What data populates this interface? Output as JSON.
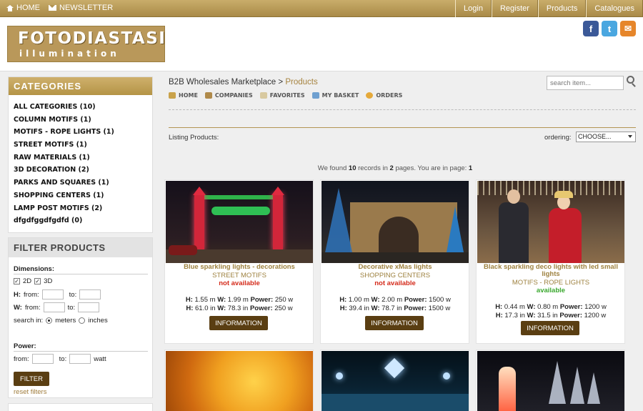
{
  "topbar": {
    "home": "HOME",
    "newsletter": "NEWSLETTER",
    "login": "Login",
    "register": "Register",
    "products": "Products",
    "catalogues": "Catalogues"
  },
  "brand": {
    "line1": "FOTODIASTASI",
    "line2": "illumination"
  },
  "social": {
    "facebook": "f",
    "twitter": "t",
    "email": "✉"
  },
  "sidebar": {
    "categories_title": "CATEGORIES",
    "categories": [
      "ALL CATEGORIES (10)",
      "COLUMN MOTIFS (1)",
      "MOTIFS - ROPE LIGHTS (1)",
      "STREET MOTIFS (1)",
      "RAW MATERIALS (1)",
      "3D DECORATION (2)",
      "PARKS AND SQUARES (1)",
      "SHOPPING CENTERS (1)",
      "LAMP POST MOTIFS (2)",
      "dfgdfggdfgdfd (0)"
    ],
    "filter": {
      "title": "FILTER PRODUCTS",
      "dimensions": "Dimensions:",
      "opt_2d": "2D",
      "opt_3d": "3D",
      "h_label": "H:",
      "w_label": "W:",
      "from": "from:",
      "to": "to:",
      "search_in": "search in:",
      "meters": "meters",
      "inches": "inches",
      "power": "Power:",
      "watt": "watt",
      "button": "FILTER",
      "reset": "reset filters"
    }
  },
  "main": {
    "breadcrumb_root": "B2B Wholesales Marketplace",
    "breadcrumb_sep": ">",
    "breadcrumb_current": "Products",
    "search_placeholder": "search item...",
    "subnav": [
      "HOME",
      "COMPANIES",
      "FAVORITES",
      "MY BASKET",
      "ORDERS"
    ],
    "listing": "Listing Products:",
    "ordering_label": "ordering:",
    "ordering_value": "CHOOSE...",
    "found": {
      "pre": "We found",
      "records": "10",
      "mid": "records in",
      "pages": "2",
      "post": "pages. You are in page:",
      "page": "1"
    }
  },
  "products": [
    {
      "title": "Blue sparkling lights - decorations",
      "category": "STREET MOTIFS",
      "availability": "not available",
      "availability_color": "#d42a1a",
      "h_m": "1.55 m",
      "w_m": "1.99 m",
      "p1": "250 w",
      "h_in": "61.0 in",
      "w_in": "78.3 in",
      "p2": "250 w",
      "button": "INFORMATION"
    },
    {
      "title": "Decorative xMas lights",
      "category": "SHOPPING CENTERS",
      "availability": "not available",
      "availability_color": "#d42a1a",
      "h_m": "1.00 m",
      "w_m": "2.00 m",
      "p1": "1500 w",
      "h_in": "39.4 in",
      "w_in": "78.7 in",
      "p2": "1500 w",
      "button": "INFORMATION"
    },
    {
      "title": "Black sparkling deco lights with led small lights",
      "category": "MOTIFS - ROPE LIGHTS",
      "availability": "available",
      "availability_color": "#3aa82e",
      "h_m": "0.44 m",
      "w_m": "0.80 m",
      "p1": "1200 w",
      "h_in": "17.3 in",
      "w_in": "31.5 in",
      "p2": "1200 w",
      "button": "INFORMATION"
    }
  ],
  "labels": {
    "h": "H:",
    "w": "W:",
    "power": "Power:"
  }
}
